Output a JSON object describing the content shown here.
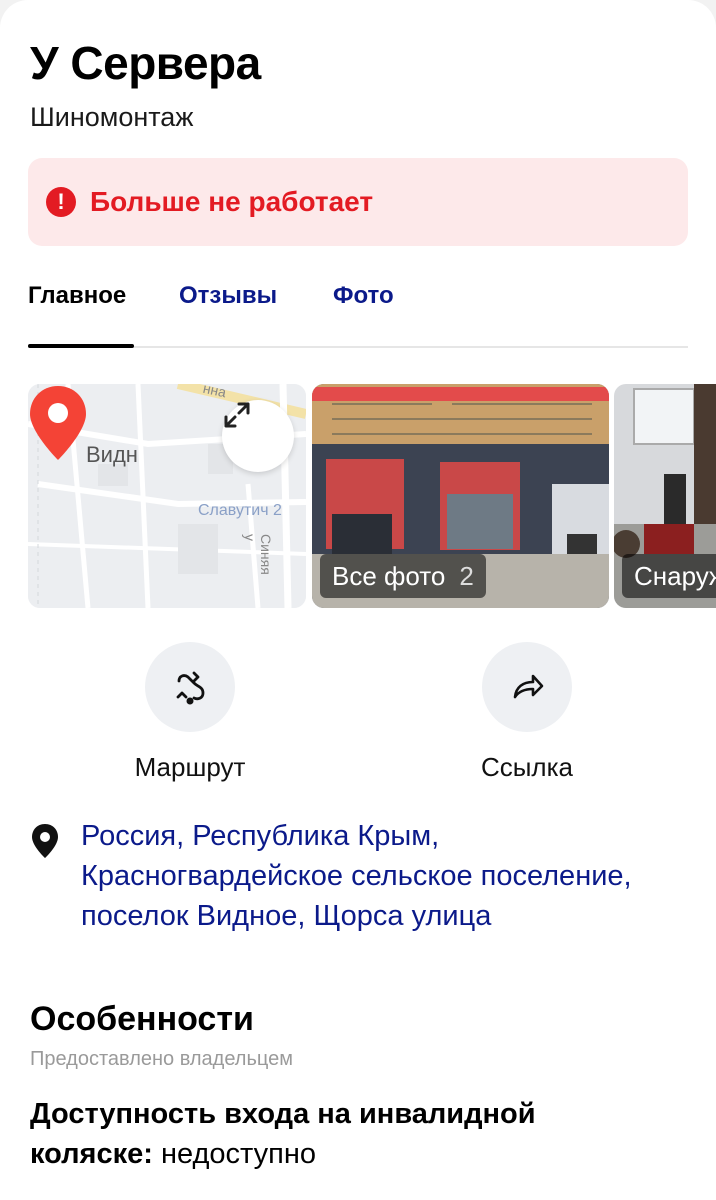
{
  "place": {
    "name": "У Сервера",
    "category": "Шиномонтаж"
  },
  "status": {
    "text": "Больше не работает",
    "color": "#e31b23"
  },
  "tabs": [
    {
      "label": "Главное",
      "active": true
    },
    {
      "label": "Отзывы",
      "active": false
    },
    {
      "label": "Фото",
      "active": false
    }
  ],
  "map": {
    "labels": {
      "village": "Видн",
      "street_slav": "Славутич 2",
      "street_sinya": "Синяя у",
      "top": "нна"
    },
    "expand_icon": "expand-icon",
    "pin_icon": "map-pin-icon"
  },
  "photos": {
    "all_label": "Все фото",
    "all_count": "2",
    "second_label": "Снаруж"
  },
  "actions": [
    {
      "label": "Маршрут",
      "icon": "route-icon"
    },
    {
      "label": "Ссылка",
      "icon": "share-icon"
    }
  ],
  "address": {
    "text": "Россия, Республика Крым, Красногвардейское сельское поселение, поселок Видное, Щорса улица"
  },
  "features": {
    "title": "Особенности",
    "provided_by": "Предоставлено владельцем",
    "accessibility_key": "Доступность входа на инвалидной коляске:",
    "accessibility_value": " недоступно"
  },
  "colors": {
    "accent_link": "#0b1a8a",
    "alert": "#e31b23",
    "alert_bg": "#fde9ea"
  }
}
